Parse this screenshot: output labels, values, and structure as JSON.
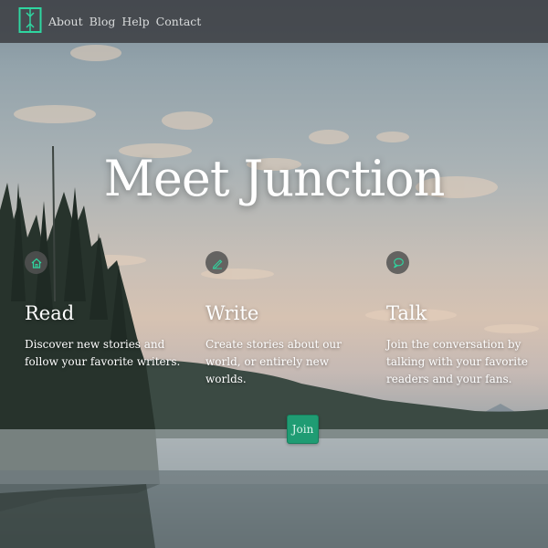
{
  "theme": {
    "accent": "#1f9c73",
    "icon_color": "#2fd6a0",
    "navbar_bg": "#3e4044"
  },
  "navbar": {
    "logo_icon": "book-logo-icon",
    "links": [
      {
        "label": "About"
      },
      {
        "label": "Blog"
      },
      {
        "label": "Help"
      },
      {
        "label": "Contact"
      }
    ]
  },
  "hero": {
    "title": "Meet Junction"
  },
  "features": [
    {
      "icon": "home-icon",
      "title": "Read",
      "text": "Discover new stories and follow your favorite writers."
    },
    {
      "icon": "pencil-icon",
      "title": "Write",
      "text": "Create stories about our world, or entirely new worlds."
    },
    {
      "icon": "speech-bubble-icon",
      "title": "Talk",
      "text": "Join the conversation by talking with your favorite readers and your fans."
    }
  ],
  "cta": {
    "join_label": "Join"
  }
}
